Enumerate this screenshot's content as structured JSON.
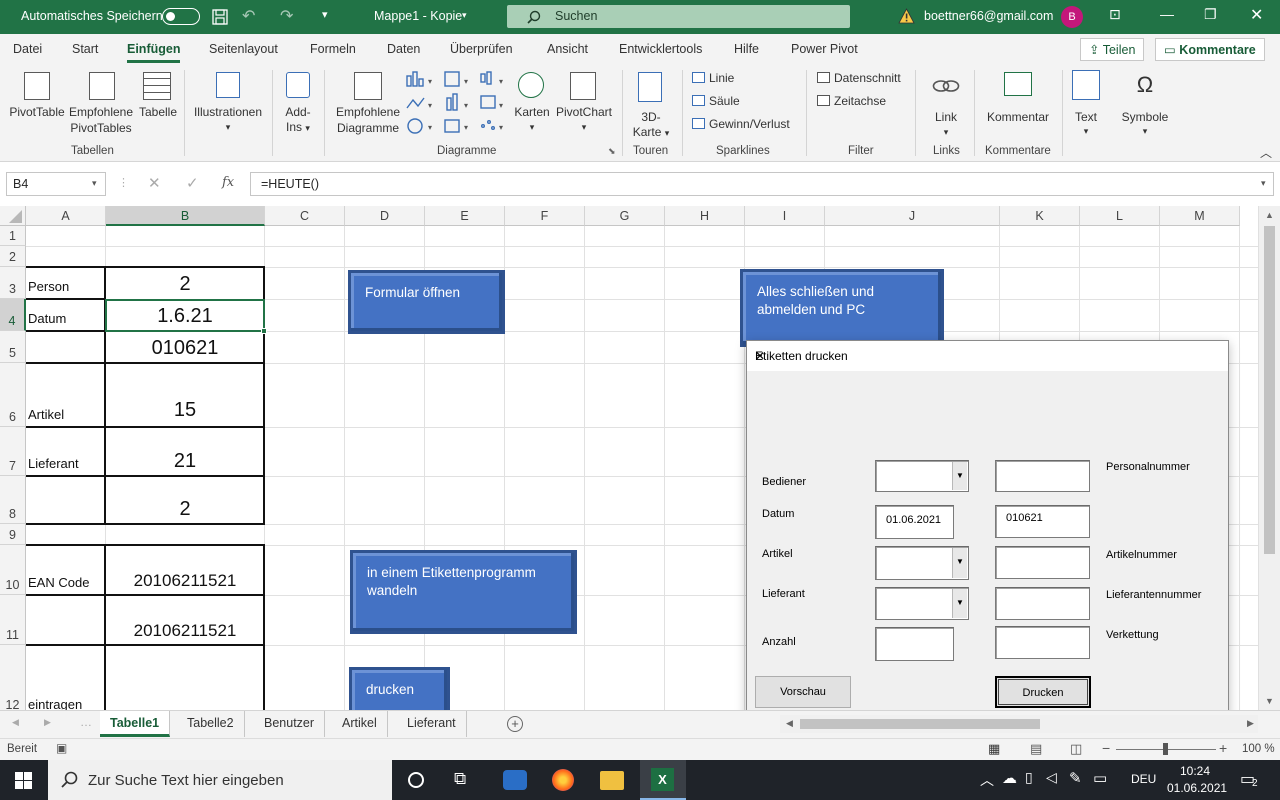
{
  "titlebar": {
    "autosave_label": "Automatisches Speichern",
    "doc_title": "Mappe1 - Kopie",
    "search_placeholder": "Suchen",
    "user_email": "boettner66@gmail.com",
    "avatar_initial": "B"
  },
  "ribbon_tabs": [
    "Datei",
    "Start",
    "Einfügen",
    "Seitenlayout",
    "Formeln",
    "Daten",
    "Überprüfen",
    "Ansicht",
    "Entwicklertools",
    "Hilfe",
    "Power Pivot"
  ],
  "active_tab": "Einfügen",
  "share_label": "Teilen",
  "comments_label": "Kommentare",
  "ribbon": {
    "pivottable": "PivotTable",
    "recommended_pivot_1": "Empfohlene",
    "recommended_pivot_2": "PivotTables",
    "table": "Tabelle",
    "group_tables": "Tabellen",
    "illustrations": "Illustrationen",
    "addins_1": "Add-",
    "addins_2": "Ins",
    "recommended_charts_1": "Empfohlene",
    "recommended_charts_2": "Diagramme",
    "maps": "Karten",
    "pivotchart": "PivotChart",
    "group_charts": "Diagramme",
    "map3d_1": "3D-",
    "map3d_2": "Karte",
    "group_tours": "Touren",
    "spark_line": "Linie",
    "spark_column": "Säule",
    "spark_winloss": "Gewinn/Verlust",
    "group_sparklines": "Sparklines",
    "slicer": "Datenschnitt",
    "timeline": "Zeitachse",
    "group_filter": "Filter",
    "link": "Link",
    "group_links": "Links",
    "comment": "Kommentar",
    "group_comments": "Kommentare",
    "text": "Text",
    "symbols": "Symbole"
  },
  "formula_bar": {
    "name_box": "B4",
    "formula": "=HEUTE()"
  },
  "columns": [
    "A",
    "B",
    "C",
    "D",
    "E",
    "F",
    "G",
    "H",
    "I",
    "J",
    "K",
    "L",
    "M"
  ],
  "rows": [
    "1",
    "2",
    "3",
    "4",
    "5",
    "6",
    "7",
    "8",
    "9",
    "10",
    "11",
    "12"
  ],
  "cells": {
    "A3": "Person",
    "B3": "2",
    "A4": "Datum",
    "B4": "1.6.21",
    "B5": "010621",
    "A6": "Artikel",
    "B6": "15",
    "A7": "Lieferant",
    "B7": "21",
    "B8": "2",
    "A10": "EAN Code",
    "B10": "20106211521",
    "B11": "20106211521",
    "A12": "eintragen"
  },
  "shapes": {
    "open_form": "Formular öffnen",
    "close_all_1": "Alles schließen und",
    "close_all_2": "abmelden  und PC",
    "convert_1": "in einem Etikettenprogramm",
    "convert_2": "wandeln",
    "print": "drucken"
  },
  "dialog": {
    "title": "Etiketten drucken",
    "label_operator": "Bediener",
    "label_date": "Datum",
    "label_article": "Artikel",
    "label_supplier": "Lieferant",
    "label_count": "Anzahl",
    "label_personnel_no": "Personalnummer",
    "label_article_no": "Artikelnummer",
    "label_supplier_no": "Lieferantennummer",
    "label_concat": "Verkettung",
    "date_value": "01.06.2021",
    "date_code_value": "010621",
    "btn_preview": "Vorschau",
    "btn_print": "Drucken"
  },
  "sheet_tabs": [
    "Tabelle1",
    "Tabelle2",
    "Benutzer",
    "Artikel",
    "Lieferant"
  ],
  "active_sheet": "Tabelle1",
  "status": {
    "ready": "Bereit",
    "zoom": "100 %"
  },
  "taskbar": {
    "search_placeholder": "Zur Suche Text hier eingeben",
    "lang": "DEU",
    "time": "10:24",
    "date": "01.06.2021",
    "notifications": "2"
  }
}
